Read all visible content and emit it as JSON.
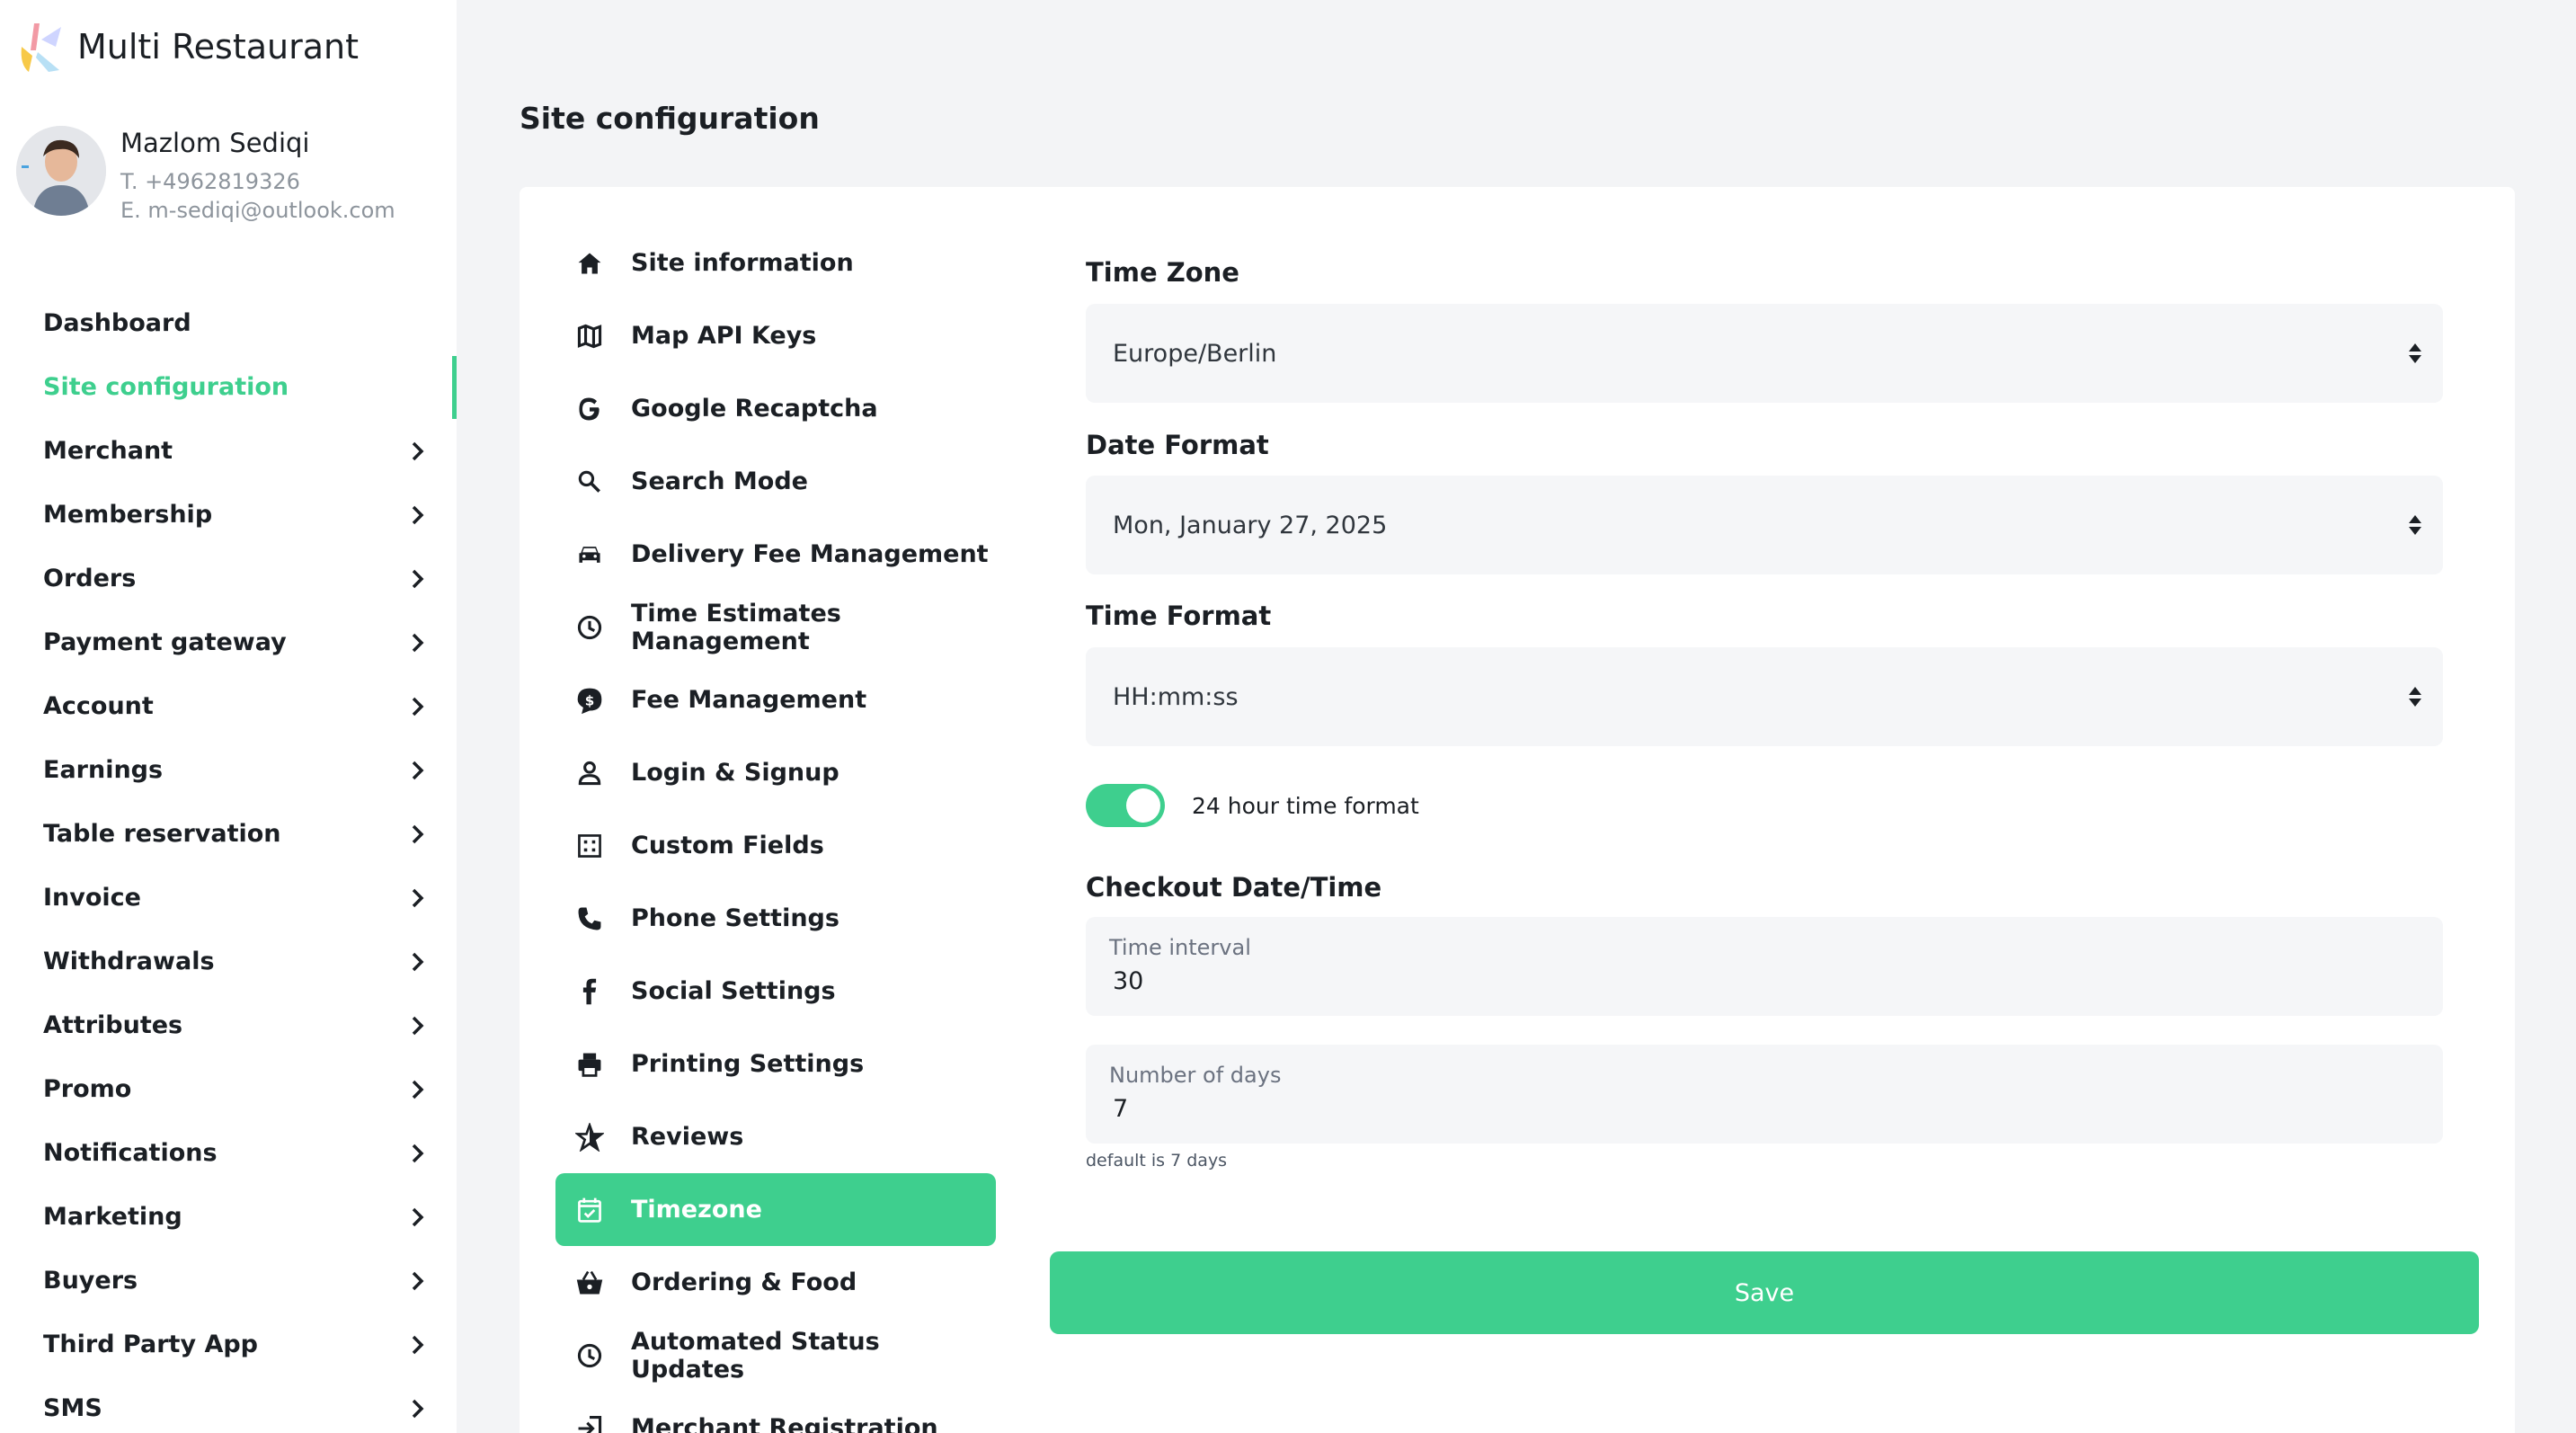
{
  "app": {
    "title": "Multi Restaurant"
  },
  "user": {
    "name": "Mazlom Sediqi",
    "phone": "T. +4962819326",
    "email": "E. m-sediqi@outlook.com"
  },
  "nav": {
    "items": [
      {
        "label": "Dashboard",
        "chevron": false,
        "active": false
      },
      {
        "label": "Site configuration",
        "chevron": false,
        "active": true
      },
      {
        "label": "Merchant",
        "chevron": true,
        "active": false
      },
      {
        "label": "Membership",
        "chevron": true,
        "active": false
      },
      {
        "label": "Orders",
        "chevron": true,
        "active": false
      },
      {
        "label": "Payment gateway",
        "chevron": true,
        "active": false
      },
      {
        "label": "Account",
        "chevron": true,
        "active": false
      },
      {
        "label": "Earnings",
        "chevron": true,
        "active": false
      },
      {
        "label": "Table reservation",
        "chevron": true,
        "active": false
      },
      {
        "label": "Invoice",
        "chevron": true,
        "active": false
      },
      {
        "label": "Withdrawals",
        "chevron": true,
        "active": false
      },
      {
        "label": "Attributes",
        "chevron": true,
        "active": false
      },
      {
        "label": "Promo",
        "chevron": true,
        "active": false
      },
      {
        "label": "Notifications",
        "chevron": true,
        "active": false
      },
      {
        "label": "Marketing",
        "chevron": true,
        "active": false
      },
      {
        "label": "Buyers",
        "chevron": true,
        "active": false
      },
      {
        "label": "Third Party App",
        "chevron": true,
        "active": false
      },
      {
        "label": "SMS",
        "chevron": true,
        "active": false
      }
    ]
  },
  "page": {
    "title": "Site configuration"
  },
  "submenu": {
    "items": [
      {
        "label": "Site information",
        "icon": "home-icon"
      },
      {
        "label": "Map API Keys",
        "icon": "map-icon"
      },
      {
        "label": "Google Recaptcha",
        "icon": "google-icon"
      },
      {
        "label": "Search Mode",
        "icon": "search-icon"
      },
      {
        "label": "Delivery Fee Management",
        "icon": "car-icon"
      },
      {
        "label": "Time Estimates Management",
        "icon": "clock-icon"
      },
      {
        "label": "Fee Management",
        "icon": "dollar-badge-icon"
      },
      {
        "label": "Login & Signup",
        "icon": "user-icon"
      },
      {
        "label": "Custom Fields",
        "icon": "fields-icon"
      },
      {
        "label": "Phone Settings",
        "icon": "phone-icon"
      },
      {
        "label": "Social Settings",
        "icon": "facebook-icon"
      },
      {
        "label": "Printing Settings",
        "icon": "printer-icon"
      },
      {
        "label": "Reviews",
        "icon": "star-icon"
      },
      {
        "label": "Timezone",
        "icon": "calendar-check-icon",
        "active": true
      },
      {
        "label": "Ordering & Food",
        "icon": "basket-icon"
      },
      {
        "label": "Automated Status Updates",
        "icon": "clock-icon"
      },
      {
        "label": "Merchant Registration",
        "icon": "login-icon"
      }
    ]
  },
  "form": {
    "timezone": {
      "label": "Time Zone",
      "value": "Europe/Berlin"
    },
    "date_format": {
      "label": "Date Format",
      "value": "Mon, January 27, 2025"
    },
    "time_format": {
      "label": "Time Format",
      "value": "HH:mm:ss"
    },
    "toggle_24h": {
      "label": "24 hour time format",
      "on": true
    },
    "checkout": {
      "heading": "Checkout Date/Time",
      "time_interval": {
        "label": "Time interval",
        "value": "30"
      },
      "number_of_days": {
        "label": "Number of days",
        "value": "7"
      },
      "hint": "default is 7 days"
    },
    "save_label": "Save"
  },
  "colors": {
    "accent": "#3ecf8e",
    "text": "#1b1f24",
    "muted": "#8d949c"
  }
}
